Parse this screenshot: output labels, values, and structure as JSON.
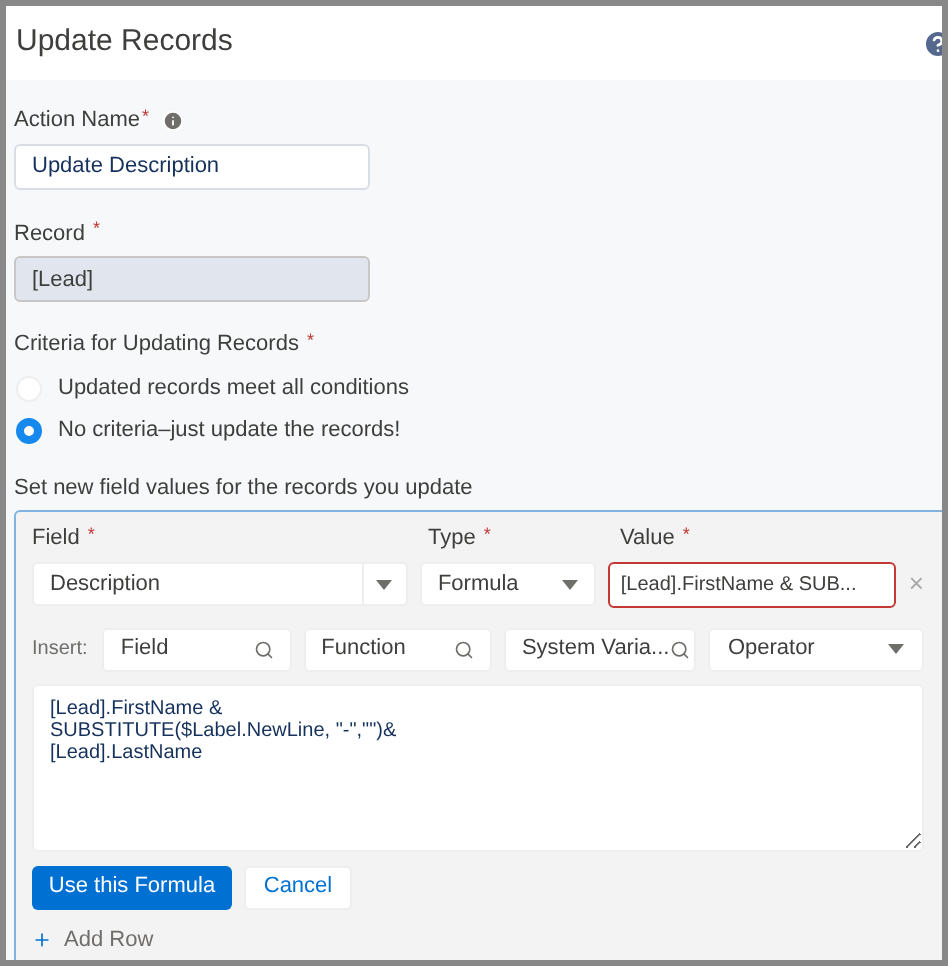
{
  "title": "Update Records",
  "action_name": {
    "label": "Action Name",
    "required_mark": "*",
    "value": "Update Description"
  },
  "record": {
    "label": "Record",
    "required_mark": "*",
    "value": "[Lead]",
    "disabled": true
  },
  "criteria": {
    "label": "Criteria for Updating Records",
    "required_mark": "*",
    "options": [
      {
        "label": "Updated records meet all conditions",
        "selected": false
      },
      {
        "label": "No criteria–just update the records!",
        "selected": true
      }
    ]
  },
  "field_values": {
    "label": "Set new field values for the records you update",
    "columns": [
      {
        "label": "Field",
        "required_mark": "*"
      },
      {
        "label": "Type",
        "required_mark": "*"
      },
      {
        "label": "Value",
        "required_mark": "*"
      }
    ],
    "row": {
      "field": "Description",
      "type": "Formula",
      "value": "[Lead].FirstName & SUB...",
      "invalid": true,
      "remove": "×"
    },
    "insert": {
      "label": "Insert:",
      "pickers": [
        {
          "kind": "search",
          "placeholder": "Field"
        },
        {
          "kind": "search",
          "placeholder": "Function"
        },
        {
          "kind": "search",
          "placeholder": "System Varia..."
        },
        {
          "kind": "select",
          "placeholder": "Operator"
        }
      ]
    },
    "formula": "[Lead].FirstName &\nSUBSTITUTE($Label.NewLine, \"-\",\"\")&\n[Lead].LastName",
    "buttons": [
      {
        "label": "Use this Formula",
        "kind": "primary"
      },
      {
        "label": "Cancel",
        "kind": "neutral"
      }
    ],
    "add_row": "Add Row"
  }
}
